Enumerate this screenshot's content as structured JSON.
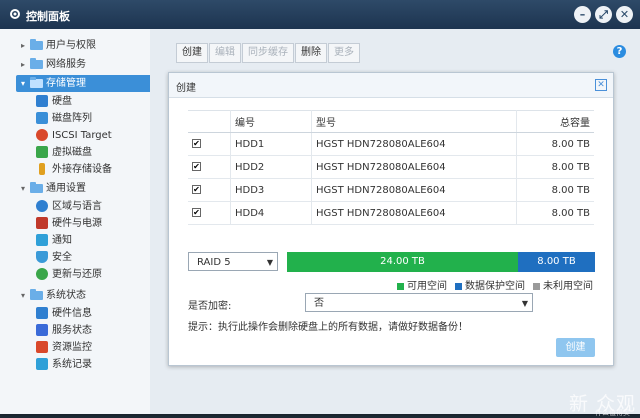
{
  "window": {
    "title": "控制面板",
    "buttons": [
      "–",
      "⤢",
      "✕"
    ]
  },
  "sidebar": {
    "groups": [
      {
        "label": "用户与权限",
        "expanded": false
      },
      {
        "label": "网络服务",
        "expanded": false
      },
      {
        "label": "存储管理",
        "expanded": true,
        "selected": true,
        "items": [
          {
            "label": "硬盘",
            "icon": "disk-icon"
          },
          {
            "label": "磁盘阵列",
            "icon": "raid-icon"
          },
          {
            "label": "ISCSI Target",
            "icon": "iscsi-icon"
          },
          {
            "label": "虚拟磁盘",
            "icon": "virtual-disk-icon"
          },
          {
            "label": "外接存储设备",
            "icon": "usb-icon"
          }
        ]
      },
      {
        "label": "通用设置",
        "expanded": true,
        "items": [
          {
            "label": "区域与语言",
            "icon": "gear-icon"
          },
          {
            "label": "硬件与电源",
            "icon": "wrench-icon"
          },
          {
            "label": "通知",
            "icon": "chat-icon"
          },
          {
            "label": "安全",
            "icon": "shield-icon"
          },
          {
            "label": "更新与还原",
            "icon": "refresh-icon"
          }
        ]
      },
      {
        "label": "系统状态",
        "expanded": true,
        "items": [
          {
            "label": "硬件信息",
            "icon": "info-icon"
          },
          {
            "label": "服务状态",
            "icon": "service-icon"
          },
          {
            "label": "资源监控",
            "icon": "monitor-icon"
          },
          {
            "label": "系统记录",
            "icon": "log-icon"
          }
        ]
      }
    ]
  },
  "toolbar": {
    "create": "创建",
    "edit": "编辑",
    "sync": "同步缓存",
    "delete": "删除",
    "more": "更多"
  },
  "dialog": {
    "title": "创建",
    "columns": {
      "number": "编号",
      "model": "型号",
      "capacity": "总容量"
    },
    "disks": [
      {
        "checked": true,
        "number": "HDD1",
        "model": "HGST HDN728080ALE604",
        "capacity": "8.00 TB"
      },
      {
        "checked": true,
        "number": "HDD2",
        "model": "HGST HDN728080ALE604",
        "capacity": "8.00 TB"
      },
      {
        "checked": true,
        "number": "HDD3",
        "model": "HGST HDN728080ALE604",
        "capacity": "8.00 TB"
      },
      {
        "checked": true,
        "number": "HDD4",
        "model": "HGST HDN728080ALE604",
        "capacity": "8.00 TB"
      }
    ],
    "raid_level": "RAID 5",
    "capacity": {
      "available_label": "24.00 TB",
      "protection_label": "8.00 TB",
      "available_fraction": 0.75,
      "protection_fraction": 0.25
    },
    "legend": {
      "available": "可用空间",
      "protection": "数据保护空间",
      "unused": "未利用空间"
    },
    "colors": {
      "available": "#22b14c",
      "protection": "#1f6fc0",
      "unused": "#9a9a9a"
    },
    "encrypt_label": "是否加密:",
    "encrypt_value": "否",
    "hint": "提示：执行此操作会删除硬盘上的所有数据，请做好数据备份！",
    "create_button": "创建"
  },
  "watermark": "新 众观",
  "watermark_sub": "什么值得买"
}
